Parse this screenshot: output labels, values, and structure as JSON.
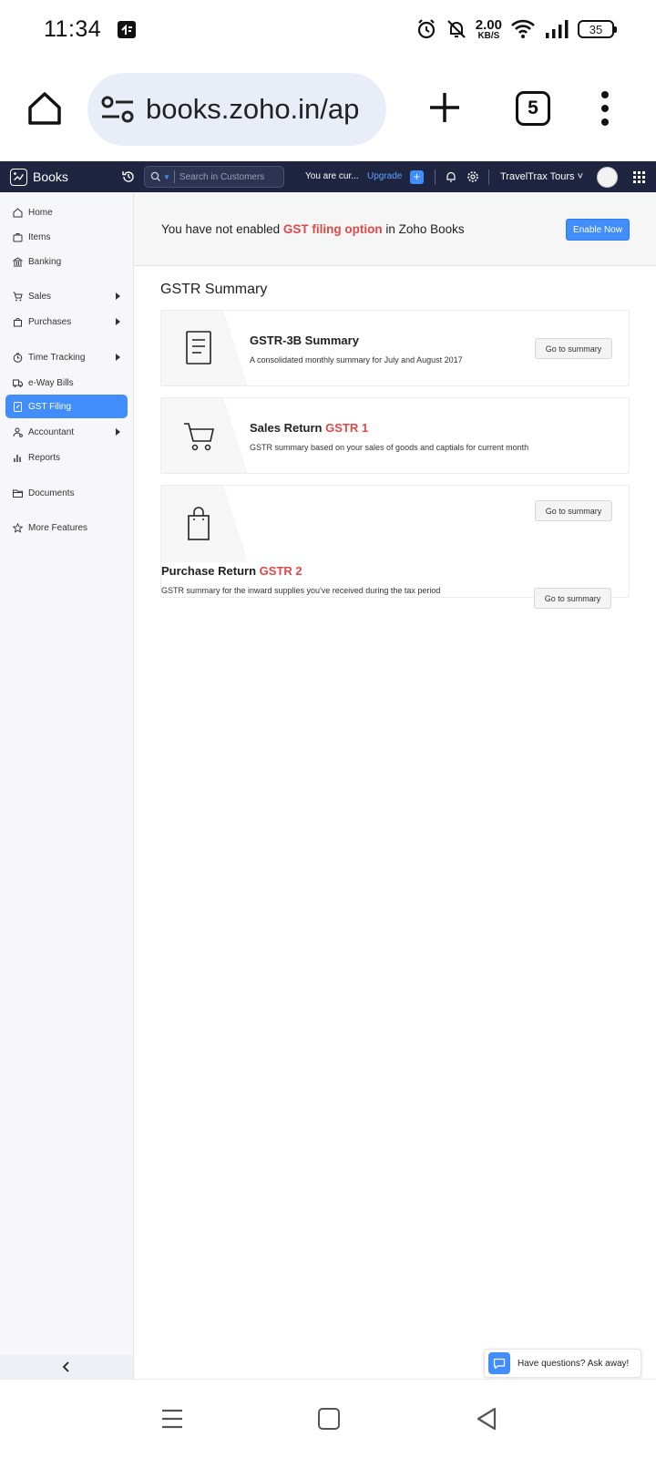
{
  "status_bar": {
    "time": "11:34",
    "net_speed_value": "2.00",
    "net_speed_unit": "KB/S",
    "battery": "35",
    "icons": [
      "alarm-icon",
      "bell-off-icon",
      "wifi-icon",
      "signal-icon",
      "battery-icon"
    ]
  },
  "browser": {
    "url": "books.zoho.in/ap",
    "tab_count": "5"
  },
  "header": {
    "brand": "Books",
    "search_placeholder": "Search in Customers",
    "trial_text": "You are cur...",
    "upgrade_label": "Upgrade",
    "quick_add_label": "+",
    "org_name": "TravelTrax Tours",
    "org_caret": "˅"
  },
  "sidebar": {
    "items": [
      {
        "label": "Home",
        "icon": "home-icon"
      },
      {
        "label": "Items",
        "icon": "items-icon"
      },
      {
        "label": "Banking",
        "icon": "bank-icon"
      },
      {
        "label": "Sales",
        "icon": "cart-icon",
        "has_arrow": true
      },
      {
        "label": "Purchases",
        "icon": "bag-icon",
        "has_arrow": true
      },
      {
        "label": "Time Tracking",
        "icon": "clock-icon",
        "has_arrow": true
      },
      {
        "label": "e-Way Bills",
        "icon": "truck-icon"
      },
      {
        "label": "GST Filing",
        "icon": "gst-icon",
        "active": true
      },
      {
        "label": "Accountant",
        "icon": "accountant-icon",
        "has_arrow": true
      },
      {
        "label": "Reports",
        "icon": "reports-icon"
      },
      {
        "label": "Documents",
        "icon": "folder-icon"
      },
      {
        "label": "More Features",
        "icon": "star-icon"
      }
    ]
  },
  "banner": {
    "text_before": "You have not enabled ",
    "highlight": "GST filing option",
    "text_after": " in Zoho Books",
    "button_label": "Enable Now"
  },
  "page_title": "GSTR Summary",
  "cards": [
    {
      "title": "GSTR-3B Summary",
      "tag": "",
      "description": "A consolidated monthly summary for July and August 2017",
      "button_label": "Go to summary",
      "icon": "document-icon"
    },
    {
      "title": "Sales Return ",
      "tag": "GSTR 1",
      "description": "GSTR summary based on your sales of goods and captials for current month",
      "button_label": "",
      "icon": "cart-icon"
    },
    {
      "title": "Purchase Return ",
      "tag": "GSTR 2",
      "description": "GSTR summary for the inward supplies you've received during the tax period",
      "button_label": "Go to summary",
      "button_label_bottom": "Go to summary",
      "icon": "shopping-bag-icon"
    }
  ],
  "chat": {
    "label": "Have questions? Ask away!"
  },
  "colors": {
    "accent": "#408dfb",
    "header_bg": "#1f2540",
    "highlight_red": "#e04848",
    "sidebar_bg": "#f7f7fb",
    "url_pill_bg": "#e8edf7"
  }
}
